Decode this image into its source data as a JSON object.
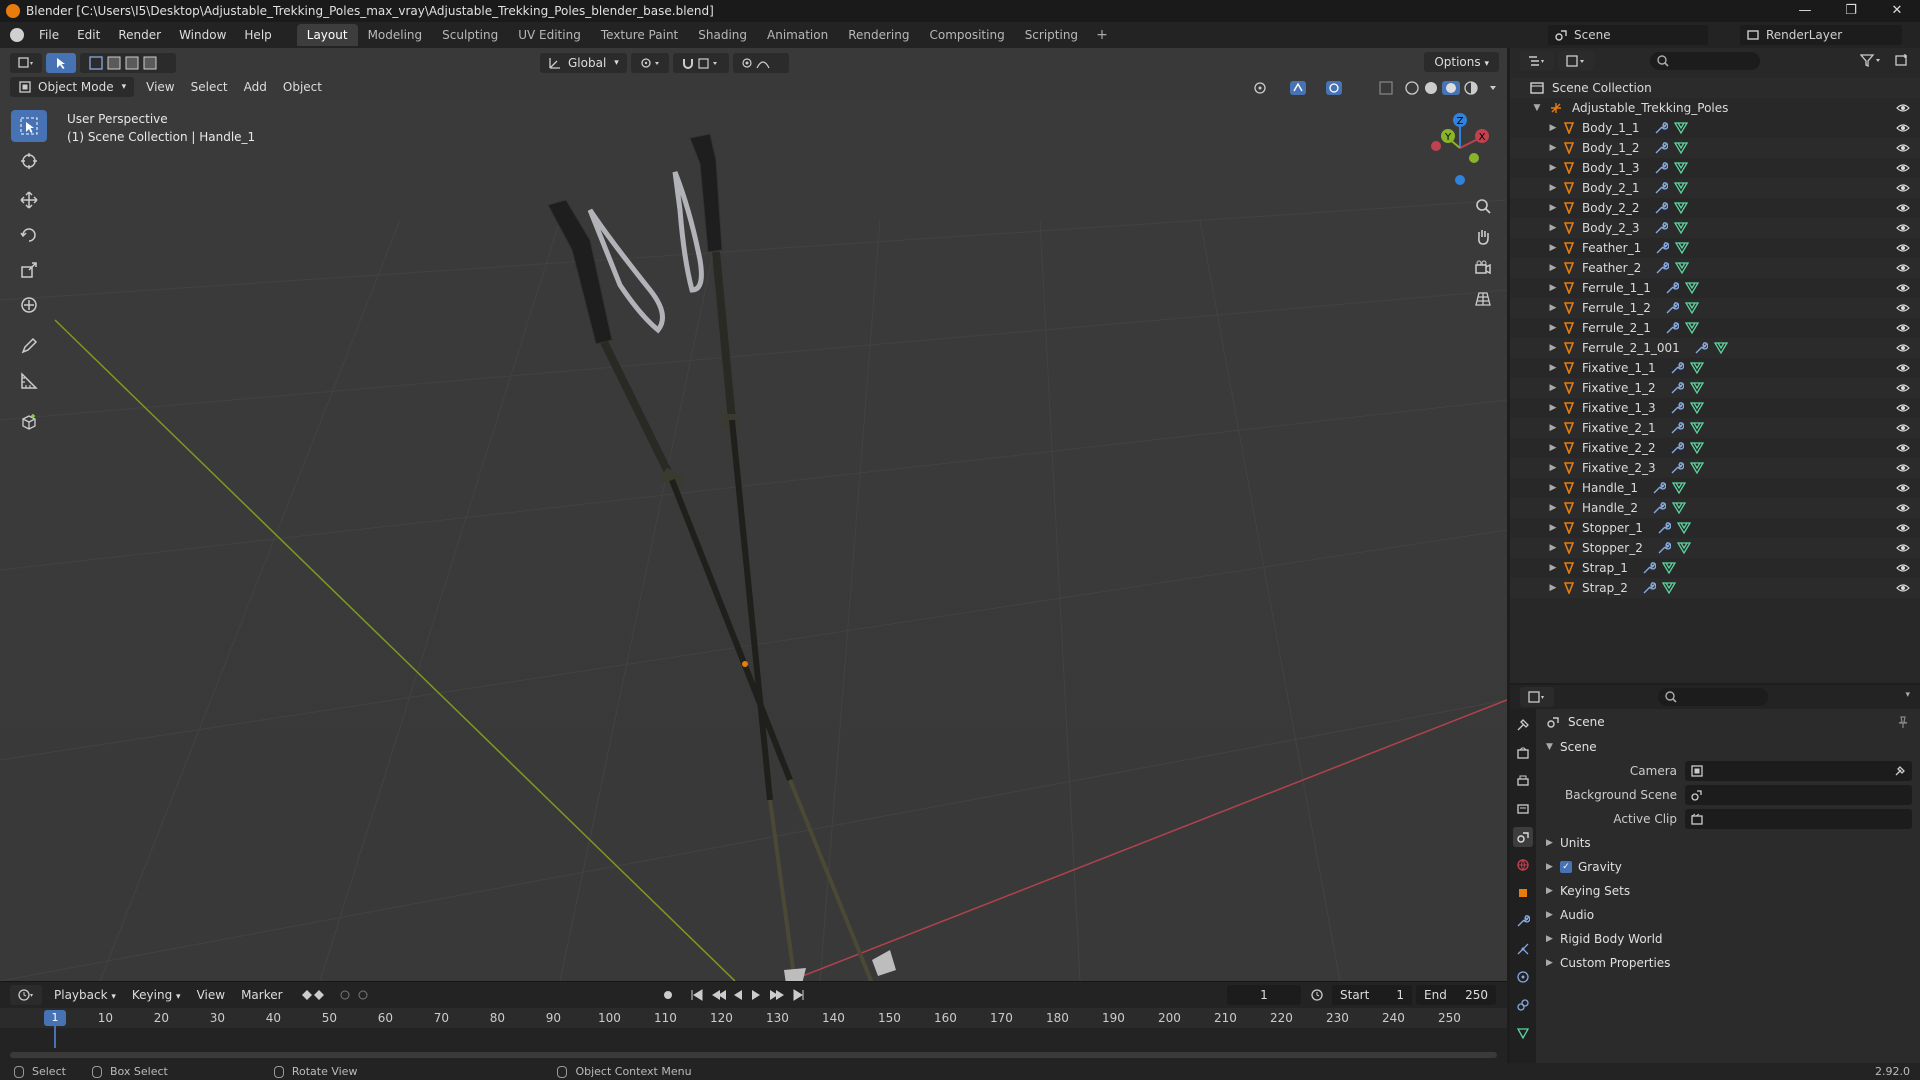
{
  "window": {
    "title": "Blender [C:\\Users\\I5\\Desktop\\Adjustable_Trekking_Poles_max_vray\\Adjustable_Trekking_Poles_blender_base.blend]",
    "controls": [
      "—",
      "❐",
      "✕"
    ]
  },
  "menus": [
    "File",
    "Edit",
    "Render",
    "Window",
    "Help"
  ],
  "workspaces": [
    {
      "label": "Layout",
      "active": true
    },
    {
      "label": "Modeling"
    },
    {
      "label": "Sculpting"
    },
    {
      "label": "UV Editing"
    },
    {
      "label": "Texture Paint"
    },
    {
      "label": "Shading"
    },
    {
      "label": "Animation"
    },
    {
      "label": "Rendering"
    },
    {
      "label": "Compositing"
    },
    {
      "label": "Scripting"
    }
  ],
  "scene_selector": "Scene",
  "view_layer": "RenderLayer",
  "viewport": {
    "mode": "Object Mode",
    "menus": [
      "View",
      "Select",
      "Add",
      "Object"
    ],
    "transform_orientation": "Global",
    "options_label": "Options",
    "info_line1": "User Perspective",
    "info_line2": "(1) Scene Collection | Handle_1",
    "gizmo": {
      "x": "X",
      "y": "Y",
      "z": "Z"
    }
  },
  "outliner": {
    "root": "Scene Collection",
    "collection": "Adjustable_Trekking_Poles",
    "objects": [
      "Body_1_1",
      "Body_1_2",
      "Body_1_3",
      "Body_2_1",
      "Body_2_2",
      "Body_2_3",
      "Feather_1",
      "Feather_2",
      "Ferrule_1_1",
      "Ferrule_1_2",
      "Ferrule_2_1",
      "Ferrule_2_1_001",
      "Fixative_1_1",
      "Fixative_1_2",
      "Fixative_1_3",
      "Fixative_2_1",
      "Fixative_2_2",
      "Fixative_2_3",
      "Handle_1",
      "Handle_2",
      "Stopper_1",
      "Stopper_2",
      "Strap_1",
      "Strap_2"
    ]
  },
  "properties": {
    "context": "Scene",
    "panel_title": "Scene",
    "fields": [
      {
        "label": "Camera"
      },
      {
        "label": "Background Scene"
      },
      {
        "label": "Active Clip"
      }
    ],
    "subpanels": [
      "Units",
      "Gravity",
      "Keying Sets",
      "Audio",
      "Rigid Body World",
      "Custom Properties"
    ]
  },
  "timeline": {
    "menus": [
      "Playback",
      "Keying",
      "View",
      "Marker"
    ],
    "current_frame": "1",
    "start_label": "Start",
    "start_value": "1",
    "end_label": "End",
    "end_value": "250",
    "ticks": [
      "10",
      "20",
      "30",
      "40",
      "50",
      "60",
      "70",
      "80",
      "90",
      "100",
      "110",
      "120",
      "130",
      "140",
      "150",
      "160",
      "170",
      "180",
      "190",
      "200",
      "210",
      "220",
      "230",
      "240",
      "250"
    ]
  },
  "statusbar": {
    "items": [
      "Select",
      "Box Select",
      "Rotate View",
      "Object Context Menu"
    ],
    "version": "2.92.0"
  },
  "colors": {
    "accent": "#4772b3",
    "object_orange": "#e87d0d",
    "mesh_green": "#5dd4a0",
    "modifier_blue": "#86a9e0",
    "axis_x": "#c1414e",
    "axis_y": "#8ab52a",
    "axis_z": "#2f83dd"
  }
}
